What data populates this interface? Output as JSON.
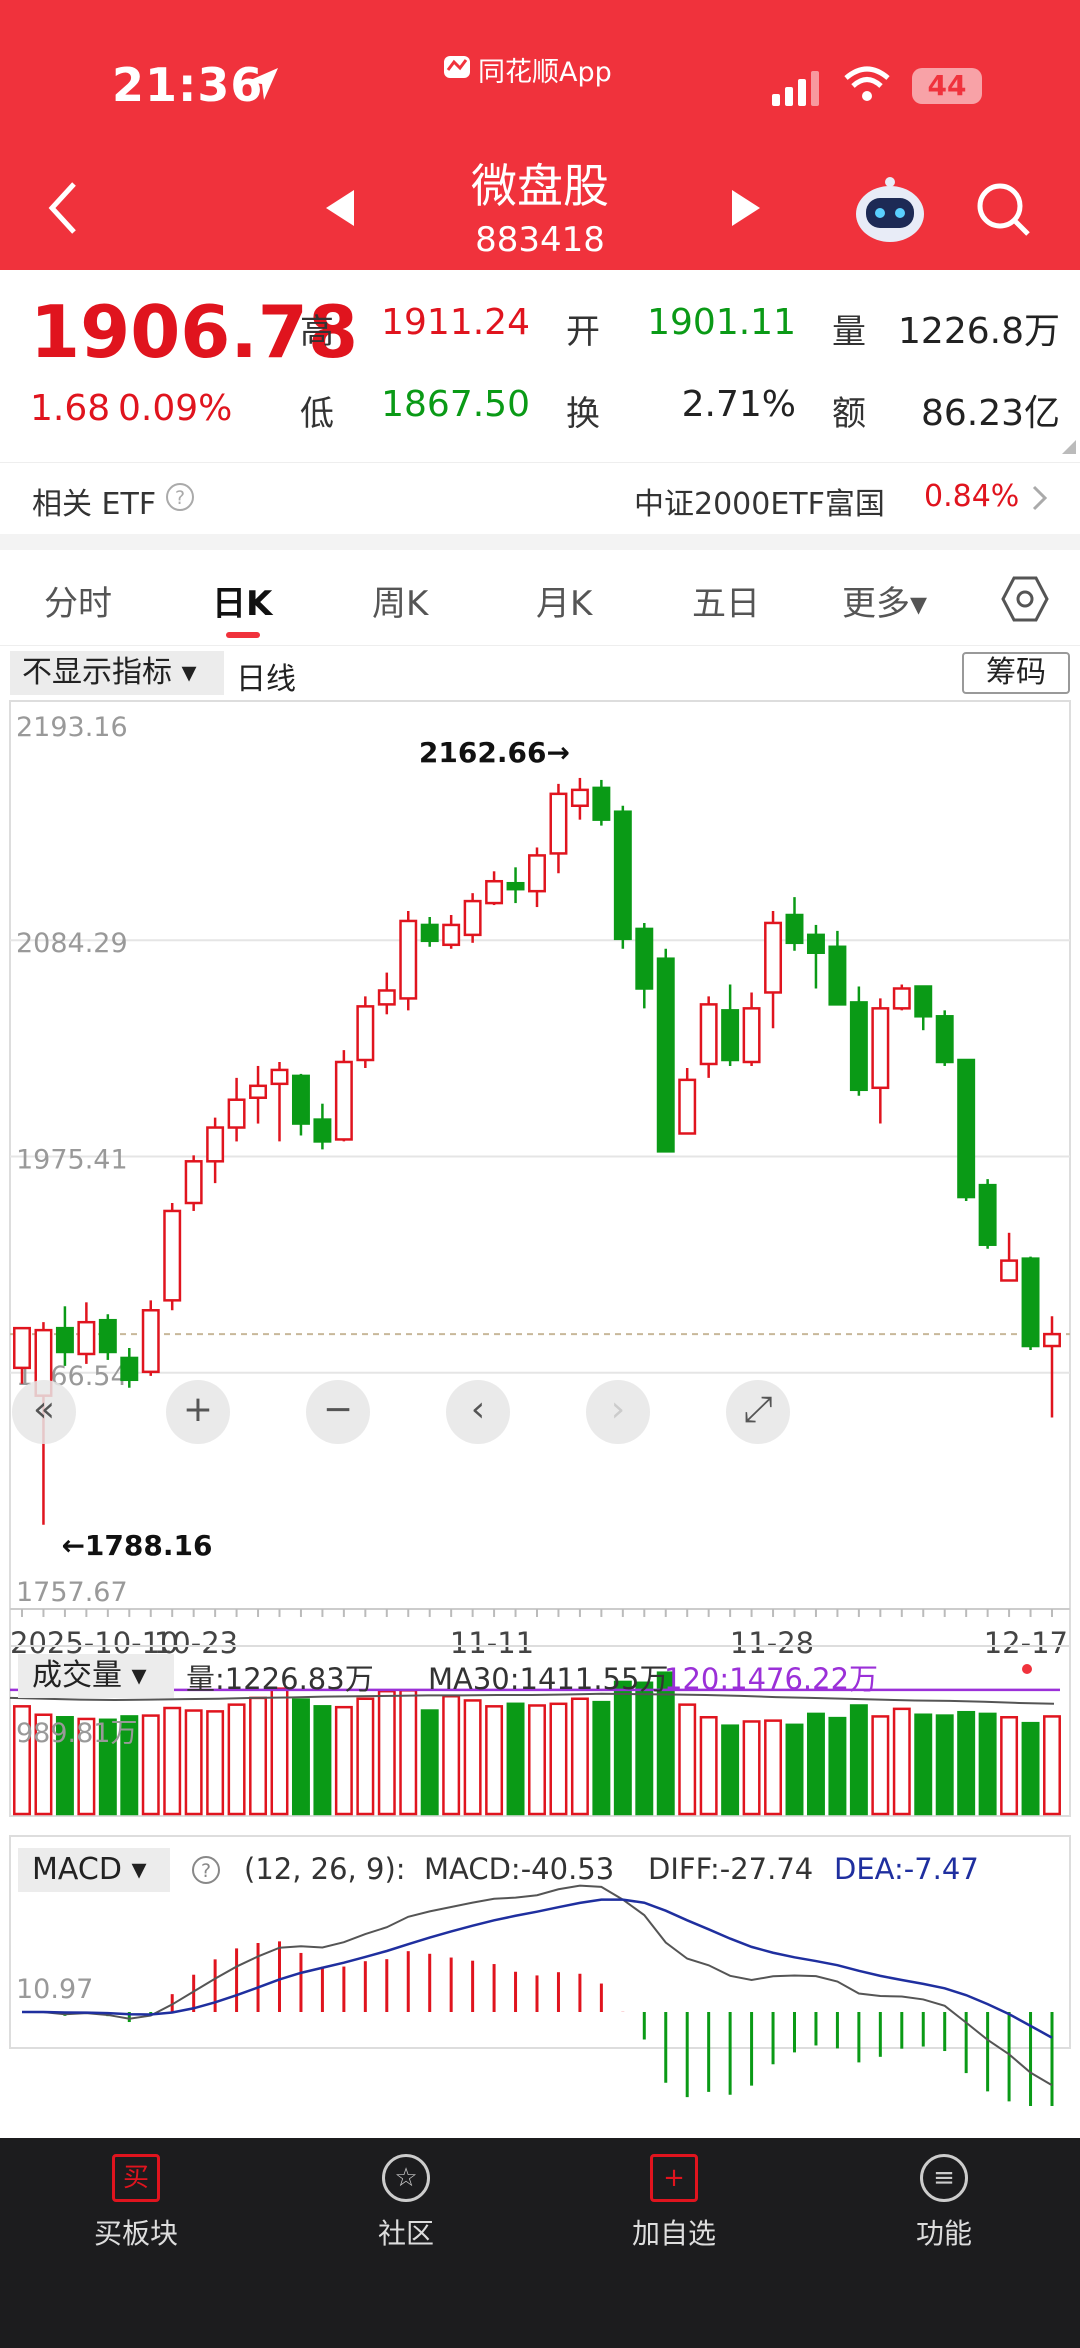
{
  "status_bar": {
    "time": "21:36",
    "app_name": "同花顺App",
    "battery": "44"
  },
  "header": {
    "title": "微盘股",
    "code": "883418"
  },
  "quote": {
    "price": "1906.78",
    "change": "1.68",
    "change_pct": "0.09%",
    "high_label": "高",
    "high": "1911.24",
    "open_label": "开",
    "open": "1901.11",
    "volume_label": "量",
    "volume": "1226.8万",
    "low_label": "低",
    "low": "1867.50",
    "turnover_label": "换",
    "turnover": "2.71%",
    "amount_label": "额",
    "amount": "86.23亿"
  },
  "etf": {
    "label": "相关 ETF",
    "name": "中证2000ETF富国",
    "pct": "0.84%"
  },
  "tabs": [
    "分时",
    "日K",
    "周K",
    "月K",
    "五日",
    "更多▾"
  ],
  "chart_toolbar": {
    "indicator": "不显示指标 ▾",
    "period": "日线",
    "chips": "筹码"
  },
  "chart_data": {
    "type": "candlestick",
    "y_labels": [
      "2193.16",
      "2084.29",
      "1975.41",
      "1866.54",
      "1757.67"
    ],
    "ylim": [
      1757.67,
      2193.16
    ],
    "max_marker": "2162.66→",
    "min_marker": "←1788.16",
    "x_labels": [
      "2025-10-10",
      "10-23",
      "11-11",
      "11-28",
      "12-17"
    ],
    "candles": [
      [
        1869,
        1889,
        1889,
        1861
      ],
      [
        1855,
        1888,
        1892,
        1790
      ],
      [
        1889,
        1877,
        1900,
        1870
      ],
      [
        1876,
        1892,
        1902,
        1871
      ],
      [
        1893,
        1877,
        1896,
        1873
      ],
      [
        1874,
        1863,
        1879,
        1859
      ],
      [
        1867,
        1898,
        1903,
        1865
      ],
      [
        1903,
        1948,
        1952,
        1898
      ],
      [
        1952,
        1973,
        1976,
        1948
      ],
      [
        1973,
        1990,
        1995,
        1962
      ],
      [
        1990,
        2004,
        2015,
        1983
      ],
      [
        2005,
        2011,
        2021,
        1992
      ],
      [
        2012,
        2019,
        2023,
        1983
      ],
      [
        2016,
        1992,
        2017,
        1986
      ],
      [
        1994,
        1983,
        2002,
        1979
      ],
      [
        1984,
        2023,
        2029,
        1983
      ],
      [
        2024,
        2051,
        2056,
        2020
      ],
      [
        2052,
        2059,
        2068,
        2047
      ],
      [
        2055,
        2094,
        2099,
        2049
      ],
      [
        2092,
        2084,
        2096,
        2081
      ],
      [
        2082,
        2092,
        2097,
        2080
      ],
      [
        2087,
        2104,
        2108,
        2083
      ],
      [
        2103,
        2114,
        2119,
        2102
      ],
      [
        2113,
        2110,
        2121,
        2103
      ],
      [
        2109,
        2127,
        2131,
        2101
      ],
      [
        2128,
        2158,
        2163,
        2118
      ],
      [
        2152,
        2160,
        2166,
        2145
      ],
      [
        2161,
        2145,
        2165,
        2142
      ],
      [
        2149,
        2085,
        2152,
        2080
      ],
      [
        2090,
        2060,
        2093,
        2050
      ],
      [
        2075,
        1978,
        2080,
        1978
      ],
      [
        1987,
        2014,
        2020,
        1987
      ],
      [
        2022,
        2052,
        2056,
        2015
      ],
      [
        2049,
        2024,
        2062,
        2021
      ],
      [
        2023,
        2050,
        2058,
        2021
      ],
      [
        2058,
        2093,
        2099,
        2040
      ],
      [
        2097,
        2083,
        2106,
        2079
      ],
      [
        2087,
        2078,
        2092,
        2060
      ],
      [
        2081,
        2052,
        2089,
        2057
      ],
      [
        2053,
        2009,
        2061,
        2006
      ],
      [
        2010,
        2050,
        2055,
        1992
      ],
      [
        2050,
        2060,
        2062,
        2049
      ],
      [
        2061,
        2046,
        2061,
        2039
      ],
      [
        2046,
        2023,
        2049,
        2021
      ],
      [
        2024,
        1955,
        2024,
        1953
      ],
      [
        1961,
        1931,
        1964,
        1929
      ],
      [
        1913,
        1923,
        1937,
        1915
      ],
      [
        1924,
        1880,
        1925,
        1878
      ],
      [
        1880,
        1886,
        1895,
        1844
      ]
    ],
    "volume_label": "成交量 ▾",
    "volume_text": "量:1226.83万",
    "ma30_text": "MA30:1411.55万",
    "ma120_text": "120:1476.22万",
    "volume_axis": "989.81万",
    "volumes": [
      1280,
      1180,
      1150,
      1130,
      1120,
      1160,
      1170,
      1260,
      1230,
      1220,
      1300,
      1380,
      1490,
      1360,
      1280,
      1270,
      1370,
      1460,
      1470,
      1230,
      1400,
      1350,
      1280,
      1310,
      1290,
      1310,
      1370,
      1330,
      1570,
      1560,
      1680,
      1300,
      1150,
      1050,
      1100,
      1110,
      1060,
      1190,
      1140,
      1290,
      1160,
      1250,
      1180,
      1170,
      1210,
      1190,
      1150,
      1080,
      1160
    ],
    "ma30_points": [
      1380,
      1370,
      1360,
      1355,
      1360,
      1365,
      1370,
      1380,
      1385,
      1395,
      1400,
      1405,
      1410,
      1410,
      1415,
      1415,
      1420,
      1430,
      1425,
      1420,
      1415,
      1405,
      1390,
      1380,
      1370,
      1360,
      1350,
      1345,
      1335,
      1320,
      1311
    ],
    "macd_label": "MACD ▾",
    "macd_params": "(12, 26, 9):",
    "macd_text": "MACD:-40.53",
    "diff_text": "DIFF:-27.74",
    "dea_text": "DEA:-7.47",
    "macd_axis": "10.97"
  },
  "bottom_nav": [
    "买板块",
    "社区",
    "加自选",
    "功能"
  ],
  "colors": {
    "brand": "#f0323c",
    "up": "#e0141e",
    "down": "#0a9a16",
    "dea": "#1f2f9f",
    "ma120": "#9b30d8"
  }
}
